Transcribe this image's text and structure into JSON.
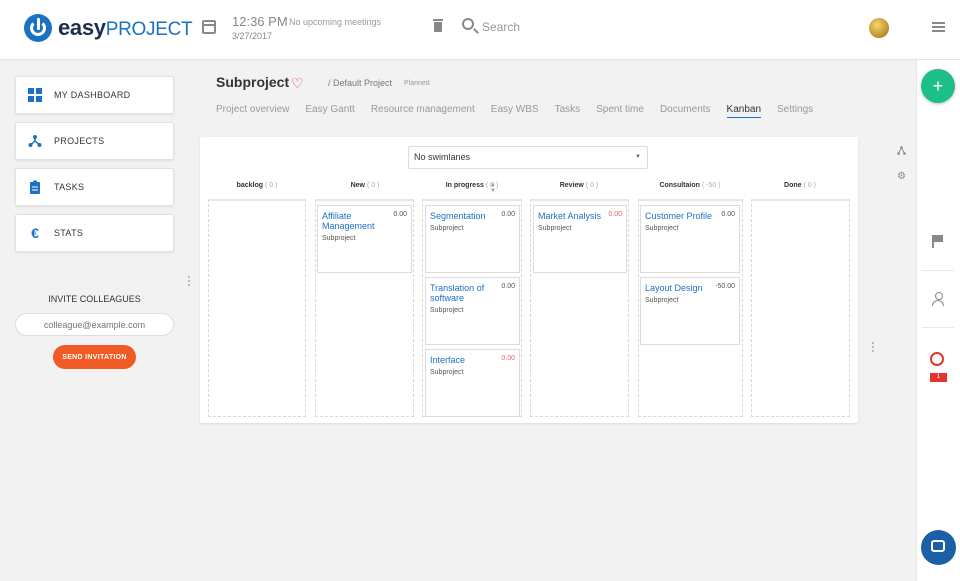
{
  "header": {
    "logo_bold": "easy",
    "logo_light": "PROJECT",
    "time": "12:36 PM",
    "date": "3/27/2017",
    "meetings": "No upcoming meetings",
    "search_label": "Search"
  },
  "sidebar": {
    "items": [
      {
        "label": "MY DASHBOARD",
        "icon": "dashboard-icon"
      },
      {
        "label": "PROJECTS",
        "icon": "projects-icon"
      },
      {
        "label": "TASKS",
        "icon": "clipboard-icon"
      },
      {
        "label": "STATS",
        "icon": "euro-icon"
      }
    ],
    "invite_title": "INVITE COLLEAGUES",
    "invite_placeholder": "colleague@example.com",
    "invite_button": "SEND INVITATION"
  },
  "page": {
    "title": "Subproject",
    "breadcrumb": "/  Default Project",
    "status": "Planned",
    "tabs": [
      "Project overview",
      "Easy Gantt",
      "Resource management",
      "Easy WBS",
      "Tasks",
      "Spent time",
      "Documents",
      "Kanban",
      "Settings"
    ],
    "active_tab": "Kanban"
  },
  "board": {
    "swimlane": "No swimlanes",
    "columns": [
      {
        "name": "backlog",
        "count": "( 0 )"
      },
      {
        "name": "New",
        "count": "( 0 )"
      },
      {
        "name": "In progress",
        "count": "( 0 )"
      },
      {
        "name": "Review",
        "count": "( 0 )"
      },
      {
        "name": "Consultaion",
        "count": "( -50 )"
      },
      {
        "name": "Done",
        "count": "( 0 )"
      }
    ],
    "cards": [
      {
        "title": "Affiliate Management",
        "value": "0.00",
        "project": "Subproject"
      },
      {
        "title": "Segmentation",
        "value": "0.00",
        "project": "Subproject"
      },
      {
        "title": "Translation of software",
        "value": "0.00",
        "project": "Subproject"
      },
      {
        "title": "Interface",
        "value": "0.00",
        "project": "Subproject"
      },
      {
        "title": "Market Analysis",
        "value": "0.00",
        "project": "Subproject"
      },
      {
        "title": "Customer Profile",
        "value": "0.00",
        "project": "Subproject"
      },
      {
        "title": "Layout Design",
        "value": "-50.00",
        "project": "Subproject"
      }
    ]
  },
  "rail": {
    "alarm_badge": "1"
  },
  "colors": {
    "brand": "#1b71c4",
    "accent_orange": "#f15a24",
    "fab_green": "#1cbf87",
    "alert_red": "#e3342f"
  }
}
